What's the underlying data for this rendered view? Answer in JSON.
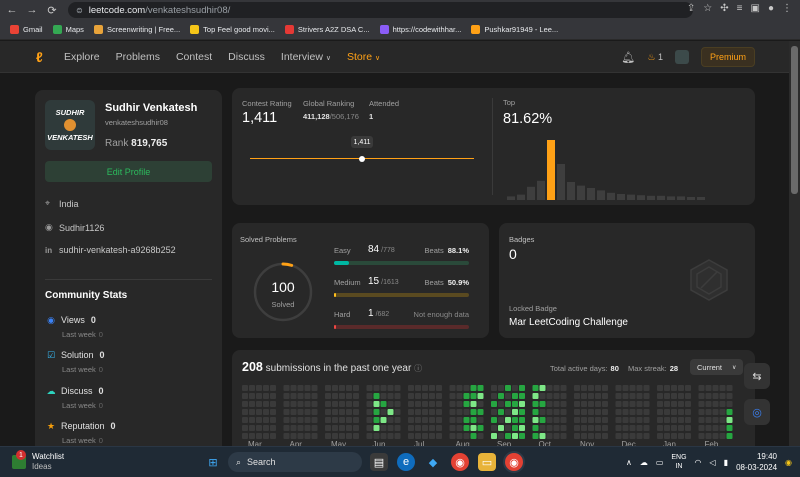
{
  "browser": {
    "url_domain": "leetcode.com",
    "url_path": "/venkateshsudhir08/",
    "bookmarks": [
      {
        "label": "Gmail",
        "color": "#ea4335"
      },
      {
        "label": "Maps",
        "color": "#34a853"
      },
      {
        "label": "Screenwriting | Free...",
        "color": "#e8a33a"
      },
      {
        "label": "Top Feel good movi...",
        "color": "#f5c518"
      },
      {
        "label": "Strivers A2Z DSA C...",
        "color": "#e53935"
      },
      {
        "label": "https://codewithhar...",
        "color": "#8a5cf6"
      },
      {
        "label": "Pushkar91949 - Lee...",
        "color": "#ffa116"
      }
    ]
  },
  "nav": {
    "links": [
      "Explore",
      "Problems",
      "Contest",
      "Discuss",
      "Interview",
      "Store"
    ],
    "streak": "1",
    "premium": "Premium"
  },
  "profile": {
    "avatar_top": "SUDHIR",
    "avatar_bottom": "VENKATESH",
    "name": "Sudhir Venkatesh",
    "username": "venkateshsudhir08",
    "rank_label": "Rank",
    "rank_value": "819,765",
    "edit_label": "Edit Profile",
    "location": "India",
    "github": "Sudhir1126",
    "linkedin": "sudhir-venkatesh-a9268b252"
  },
  "community": {
    "title": "Community Stats",
    "items": [
      {
        "label": "Views",
        "value": "0",
        "week": "Last week",
        "week_value": "0",
        "color": "#3b82f6"
      },
      {
        "label": "Solution",
        "value": "0",
        "week": "Last week",
        "week_value": "0",
        "color": "#38bdf8"
      },
      {
        "label": "Discuss",
        "value": "0",
        "week": "Last week",
        "week_value": "0",
        "color": "#2dd4bf"
      },
      {
        "label": "Reputation",
        "value": "0",
        "week": "Last week",
        "week_value": "0",
        "color": "#f59e0b"
      }
    ]
  },
  "contest": {
    "rating_label": "Contest Rating",
    "rating": "1,411",
    "global_label": "Global Ranking",
    "global_value": "411,128",
    "global_total": "/506,176",
    "attended_label": "Attended",
    "attended_value": "1",
    "tooltip": "1,411",
    "top_label": "Top",
    "top_value": "81.62%",
    "highlight_color": "#ffa116",
    "bar_levels": [
      0.06,
      0.09,
      0.22,
      0.32,
      1.0,
      0.6,
      0.3,
      0.24,
      0.2,
      0.16,
      0.12,
      0.1,
      0.09,
      0.08,
      0.07,
      0.07,
      0.06,
      0.06,
      0.05,
      0.05
    ],
    "highlight_index": 4
  },
  "solved": {
    "title": "Solved Problems",
    "total": "100",
    "total_label": "Solved",
    "ring_fraction": 0.05,
    "rows": [
      {
        "label": "Easy",
        "count": "84",
        "total": "/778",
        "beats_label": "Beats",
        "beats": "88.1%",
        "fraction": 0.108,
        "color": "#00b8a3",
        "track": "#2a4a3a"
      },
      {
        "label": "Medium",
        "count": "15",
        "total": "/1613",
        "beats_label": "Beats",
        "beats": "50.9%",
        "fraction": 0.0093,
        "color": "#ffc01e",
        "track": "#5a4a20"
      },
      {
        "label": "Hard",
        "count": "1",
        "total": "/682",
        "beats_label": "",
        "beats": "Not enough data",
        "fraction": 0.0015,
        "color": "#ef4743",
        "track": "#5a2a2a"
      }
    ]
  },
  "badges": {
    "title": "Badges",
    "count": "0",
    "locked_label": "Locked Badge",
    "locked_name": "Mar LeetCoding Challenge"
  },
  "submissions": {
    "count": "208",
    "label": "submissions in the past one year",
    "active_label": "Total active days:",
    "active_value": "80",
    "streak_label": "Max streak:",
    "streak_value": "28",
    "selector": "Current",
    "months": [
      "Mar",
      "Apr",
      "May",
      "Jun",
      "Jul",
      "Aug",
      "Sep",
      "Oct",
      "Nov",
      "Dec",
      "Jan",
      "Feb"
    ]
  },
  "taskbar": {
    "widget_title": "Watchlist",
    "widget_sub": "Ideas",
    "widget_badge": "1",
    "search": "Search",
    "lang_top": "ENG",
    "lang_bottom": "IN",
    "time": "19:40",
    "date": "08-03-2024"
  }
}
